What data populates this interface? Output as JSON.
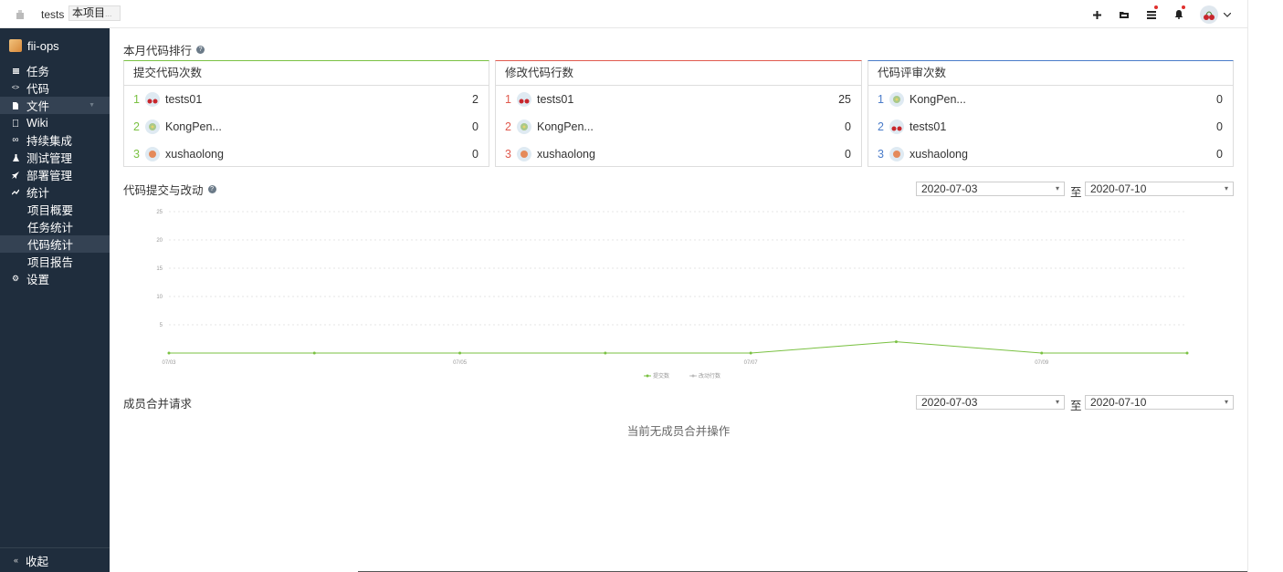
{
  "topbar": {
    "project": "tests",
    "tooltip": "本项目",
    "tooltip_ghost": "...",
    "icons": [
      "plus-icon",
      "folder-icon",
      "tasks-icon",
      "bell-icon"
    ]
  },
  "sidebar": {
    "title": "fii-ops",
    "items": [
      {
        "label": "任务",
        "icon": "list-icon"
      },
      {
        "label": "代码",
        "icon": "code-icon"
      },
      {
        "label": "文件",
        "icon": "file-icon",
        "active": true
      },
      {
        "label": "Wiki",
        "icon": "book-icon"
      },
      {
        "label": "持续集成",
        "icon": "infinity-icon"
      },
      {
        "label": "测试管理",
        "icon": "flask-icon"
      },
      {
        "label": "部署管理",
        "icon": "rocket-icon"
      },
      {
        "label": "统计",
        "icon": "chart-icon"
      }
    ],
    "sub_items": [
      {
        "label": "项目概要"
      },
      {
        "label": "任务统计"
      },
      {
        "label": "代码统计",
        "active": true
      },
      {
        "label": "项目报告"
      }
    ],
    "settings": "设置",
    "collapse": "收起"
  },
  "ranking": {
    "title": "本月代码排行",
    "cards": [
      {
        "title": "提交代码次数",
        "accent": "#7ac142",
        "rows": [
          {
            "rank": "1",
            "name": "tests01",
            "value": "2",
            "avatar": "cherry"
          },
          {
            "rank": "2",
            "name": "KongPen...",
            "value": "0",
            "avatar": "flower"
          },
          {
            "rank": "3",
            "name": "xushaolong",
            "value": "0",
            "avatar": "orange"
          }
        ]
      },
      {
        "title": "修改代码行数",
        "accent": "#e05a4e",
        "rows": [
          {
            "rank": "1",
            "name": "tests01",
            "value": "25",
            "avatar": "cherry"
          },
          {
            "rank": "2",
            "name": "KongPen...",
            "value": "0",
            "avatar": "flower"
          },
          {
            "rank": "3",
            "name": "xushaolong",
            "value": "0",
            "avatar": "orange"
          }
        ]
      },
      {
        "title": "代码评审次数",
        "accent": "#4a7cc9",
        "rows": [
          {
            "rank": "1",
            "name": "KongPen...",
            "value": "0",
            "avatar": "flower"
          },
          {
            "rank": "2",
            "name": "tests01",
            "value": "0",
            "avatar": "cherry"
          },
          {
            "rank": "3",
            "name": "xushaolong",
            "value": "0",
            "avatar": "orange"
          }
        ]
      }
    ]
  },
  "commits": {
    "title": "代码提交与改动",
    "date_from": "2020-07-03",
    "to_label": "至",
    "date_to": "2020-07-10"
  },
  "merge": {
    "title": "成员合并请求",
    "date_from": "2020-07-03",
    "to_label": "至",
    "date_to": "2020-07-10",
    "empty": "当前无成员合并操作"
  },
  "chart_data": {
    "type": "line",
    "x": [
      "07/03",
      "07/04",
      "07/05",
      "07/06",
      "07/07",
      "07/08",
      "07/09",
      "07/10"
    ],
    "x_tick_labels": [
      "07/03",
      "07/05",
      "07/07",
      "07/09"
    ],
    "y_ticks": [
      "5",
      "10",
      "15",
      "20",
      "25"
    ],
    "ylim": [
      0,
      25
    ],
    "grid": true,
    "legend_position": "bottom",
    "series": [
      {
        "name": "提交数",
        "color": "#7ac142",
        "values": [
          0,
          0,
          0,
          0,
          0,
          2,
          0,
          0
        ]
      },
      {
        "name": "改动行数",
        "color": "#bbbbbb",
        "values": []
      }
    ]
  }
}
